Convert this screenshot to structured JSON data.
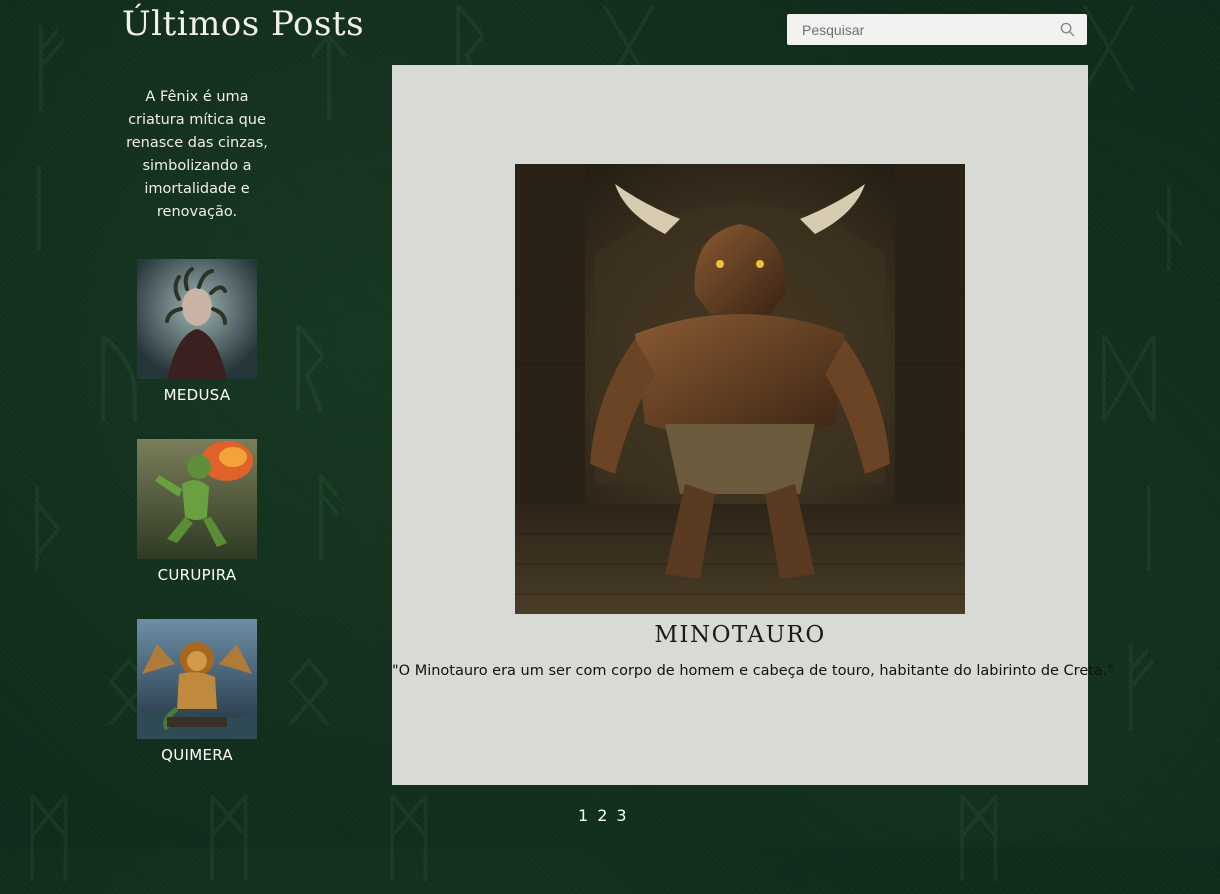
{
  "header": {
    "title": "Últimos Posts"
  },
  "search": {
    "placeholder": "Pesquisar",
    "value": "",
    "icon": "search-icon"
  },
  "sidebar": {
    "intro": "A Fênix é uma criatura mítica que renasce das cinzas, simbolizando a imortalidade e renovação.",
    "posts": [
      {
        "label": "MEDUSA"
      },
      {
        "label": "CURUPIRA"
      },
      {
        "label": "QUIMERA"
      }
    ]
  },
  "featured": {
    "title": "MINOTAURO",
    "quote": "\"O Minotauro era um ser com corpo de homem e cabeça de touro, habitante do labirinto de Creta.\""
  },
  "pagination": {
    "pages": [
      "1",
      "2",
      "3"
    ]
  },
  "colors": {
    "background": "#0f2a1a",
    "card": "#d8dbd5",
    "text_light": "#ffffff"
  }
}
